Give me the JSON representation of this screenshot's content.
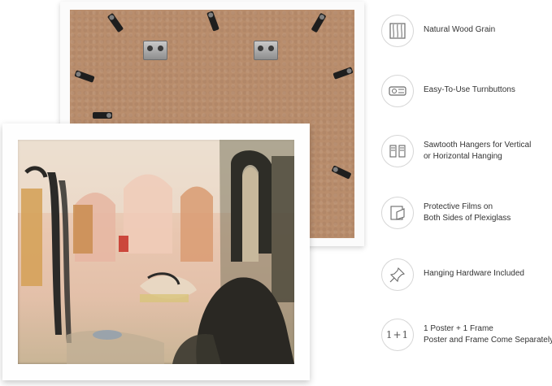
{
  "features": [
    {
      "icon": "wood-grain-icon",
      "lines": [
        "Natural Wood Grain"
      ]
    },
    {
      "icon": "turnbutton-icon",
      "lines": [
        "Easy-To-Use Turnbuttons"
      ]
    },
    {
      "icon": "sawtooth-hanger-icon",
      "lines": [
        "Sawtooth Hangers for Vertical",
        "or Horizontal Hanging"
      ]
    },
    {
      "icon": "protective-film-icon",
      "lines": [
        "Protective Films on",
        "Both Sides of Plexiglass"
      ]
    },
    {
      "icon": "push-pin-icon",
      "lines": [
        "Hanging Hardware Included"
      ]
    },
    {
      "icon": "one-plus-one-icon",
      "icon_text": "1+1",
      "lines": [
        "1 Poster + 1 Frame",
        "Poster and Frame Come Separately"
      ]
    }
  ],
  "colors": {
    "frame": "#fefefe",
    "backboard": "#b98d6c",
    "hardware": "#1e1e1e",
    "icon_border": "#d6d6d6",
    "text": "#333333"
  }
}
